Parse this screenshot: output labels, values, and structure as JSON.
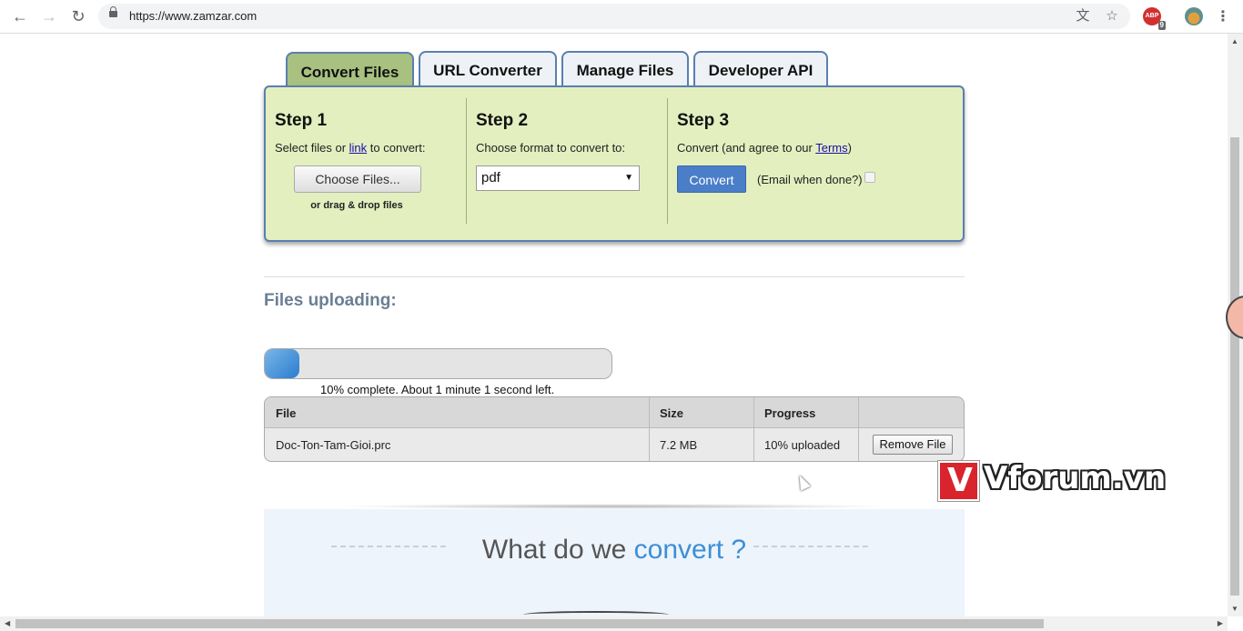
{
  "browser": {
    "url": "https://www.zamzar.com",
    "back_glyph": "←",
    "forward_glyph": "→",
    "reload_glyph": "↻",
    "abp_label": "ABP",
    "abp_count": "9",
    "menu_glyph": "⋮"
  },
  "tabs": [
    {
      "label": "Convert Files",
      "active": true
    },
    {
      "label": "URL Converter",
      "active": false
    },
    {
      "label": "Manage Files",
      "active": false
    },
    {
      "label": "Developer API",
      "active": false
    }
  ],
  "steps": {
    "step1": {
      "title": "Step 1",
      "desc_before": "Select files or ",
      "desc_link": "link",
      "desc_after": " to convert:",
      "choose_button": "Choose Files...",
      "drag_note": "or drag & drop files"
    },
    "step2": {
      "title": "Step 2",
      "desc": "Choose format to convert to:",
      "selected_format": "pdf"
    },
    "step3": {
      "title": "Step 3",
      "desc_before": "Convert (and agree to our ",
      "desc_link": "Terms",
      "desc_after": ")",
      "convert_button": "Convert",
      "email_label": "(Email when done?)",
      "email_checked": false
    }
  },
  "upload": {
    "title": "Files uploading:",
    "progress_percent": 10,
    "progress_text": "10% complete. About 1 minute 1 second left.",
    "table": {
      "headers": [
        "File",
        "Size",
        "Progress",
        ""
      ],
      "rows": [
        {
          "file": "Doc-Ton-Tam-Gioi.prc",
          "size": "7.2 MB",
          "progress": "10% uploaded",
          "action": "Remove File"
        }
      ]
    }
  },
  "watermark": {
    "logo_letter": "V",
    "text": "Vforum.vn"
  },
  "banner": {
    "title_part1": "What do we ",
    "title_part2": "convert ?"
  }
}
